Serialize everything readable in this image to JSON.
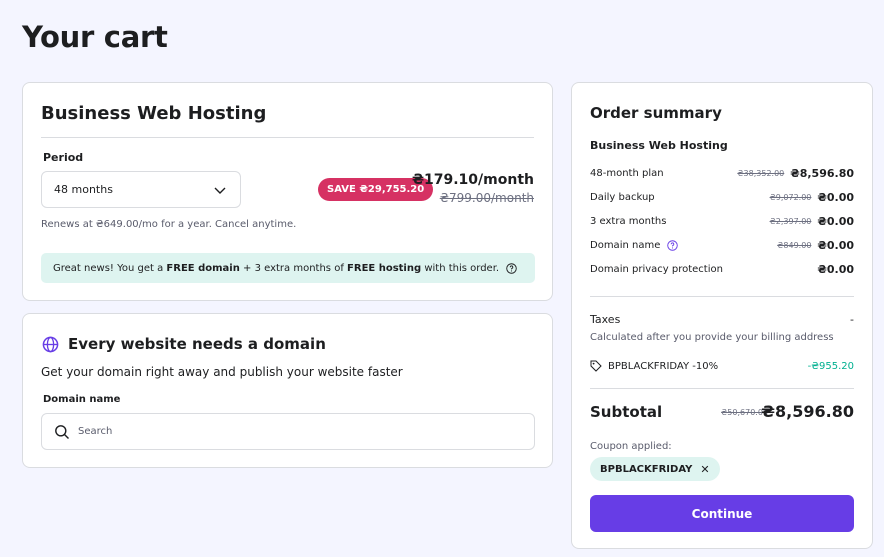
{
  "page": {
    "title": "Your cart"
  },
  "hosting": {
    "title": "Business Web Hosting",
    "period_label": "Period",
    "period_value": "48 months",
    "save_badge": "SAVE ₴29,755.20",
    "price": "₴179.10/month",
    "old_price": "₴799.00/month",
    "renews": "Renews at ₴649.00/mo for a year. Cancel anytime.",
    "promo": {
      "pre": "Great news! You get a ",
      "free_domain": "FREE domain",
      "mid": " + 3 extra months of ",
      "free_hosting": "FREE hosting",
      "post": " with this order."
    }
  },
  "domain": {
    "title": "Every website needs a domain",
    "subtitle": "Get your domain right away and publish your website faster",
    "label": "Domain name",
    "placeholder": "Search"
  },
  "summary": {
    "title": "Order summary",
    "product": "Business Web Hosting",
    "rows": [
      {
        "label": "48-month plan",
        "old": "₴38,352.00",
        "value": "₴8,596.80"
      },
      {
        "label": "Daily backup",
        "old": "₴9,072.00",
        "value": "₴0.00"
      },
      {
        "label": "3 extra months",
        "old": "₴2,397.00",
        "value": "₴0.00"
      },
      {
        "label": "Domain name",
        "old": "₴849.00",
        "value": "₴0.00"
      },
      {
        "label": "Domain privacy protection",
        "old": "",
        "value": "₴0.00"
      }
    ],
    "taxes_label": "Taxes",
    "taxes_value": "-",
    "taxes_note": "Calculated after you provide your billing address",
    "coupon_code": "BPBLACKFRIDAY -10%",
    "coupon_discount": "-₴955.20",
    "subtotal_label": "Subtotal",
    "subtotal_old": "₴50,670.00",
    "subtotal_value": "₴8,596.80",
    "coupon_applied_label": "Coupon applied:",
    "coupon_chip": "BPBLACKFRIDAY",
    "coupon_remove": "✕",
    "continue_label": "Continue"
  },
  "colors": {
    "accent": "#673de6",
    "save_badge": "#d63163",
    "promo_bg": "#def4f0",
    "discount": "#00b090"
  }
}
